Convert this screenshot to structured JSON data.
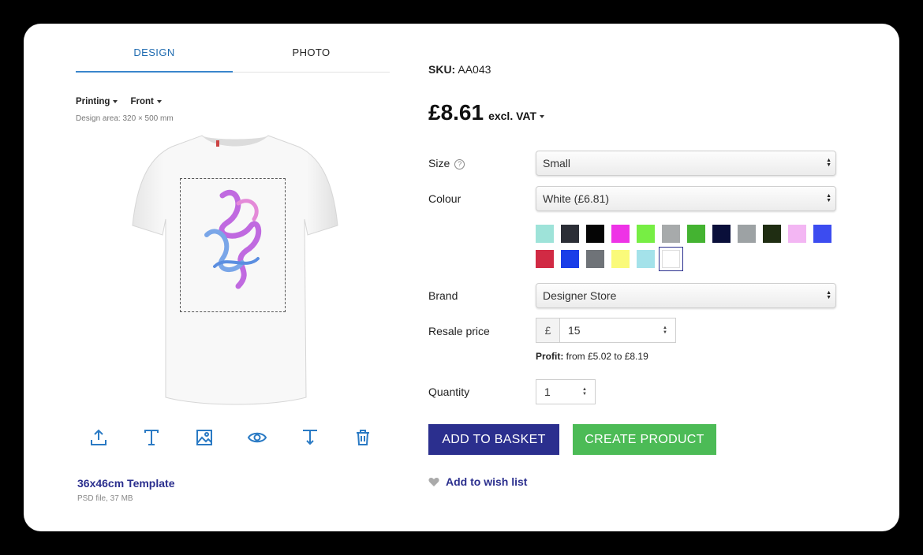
{
  "tabs": [
    {
      "label": "DESIGN"
    },
    {
      "label": "PHOTO"
    }
  ],
  "design": {
    "printing_label": "Printing",
    "side_label": "Front",
    "area_text": "Design area: 320 × 500 mm"
  },
  "tools": [
    "upload-icon",
    "text-icon",
    "image-icon",
    "preview-eye-icon",
    "text-align-icon",
    "trash-icon"
  ],
  "template": {
    "link": "36x46cm Template",
    "meta": "PSD file, 37 MB"
  },
  "product": {
    "sku_label": "SKU:",
    "sku_value": "AA043",
    "price": "£8.61",
    "vat_label": "excl. VAT"
  },
  "form": {
    "size_label": "Size",
    "size_help": "?",
    "size_value": "Small",
    "colour_label": "Colour",
    "colour_value": "White (£6.81)",
    "brand_label": "Brand",
    "brand_value": "Designer Store",
    "resale_label": "Resale price",
    "currency": "£",
    "resale_value": "15",
    "profit_label": "Profit:",
    "profit_text": "from £5.02 to £8.19",
    "quantity_label": "Quantity",
    "quantity_value": "1"
  },
  "swatches": [
    "#9ee3d9",
    "#2b2e36",
    "#050505",
    "#ee33e6",
    "#77ee44",
    "#a7aaab",
    "#44b331",
    "#0a0f3a",
    "#9da2a4",
    "#1f2d12",
    "#f3b6f3",
    "#3c4cf0",
    "#d12a44",
    "#1a3ee8",
    "#6f7378",
    "#fafa7a",
    "#a4e2ea",
    "#ffffff"
  ],
  "selected_swatch": 17,
  "buttons": {
    "basket": "ADD TO BASKET",
    "create": "CREATE PRODUCT"
  },
  "wishlist": "Add to wish list",
  "colors": {
    "primary": "#2b2f8e",
    "accent_green": "#4cbb56",
    "tab_active": "#1f6bb0"
  }
}
